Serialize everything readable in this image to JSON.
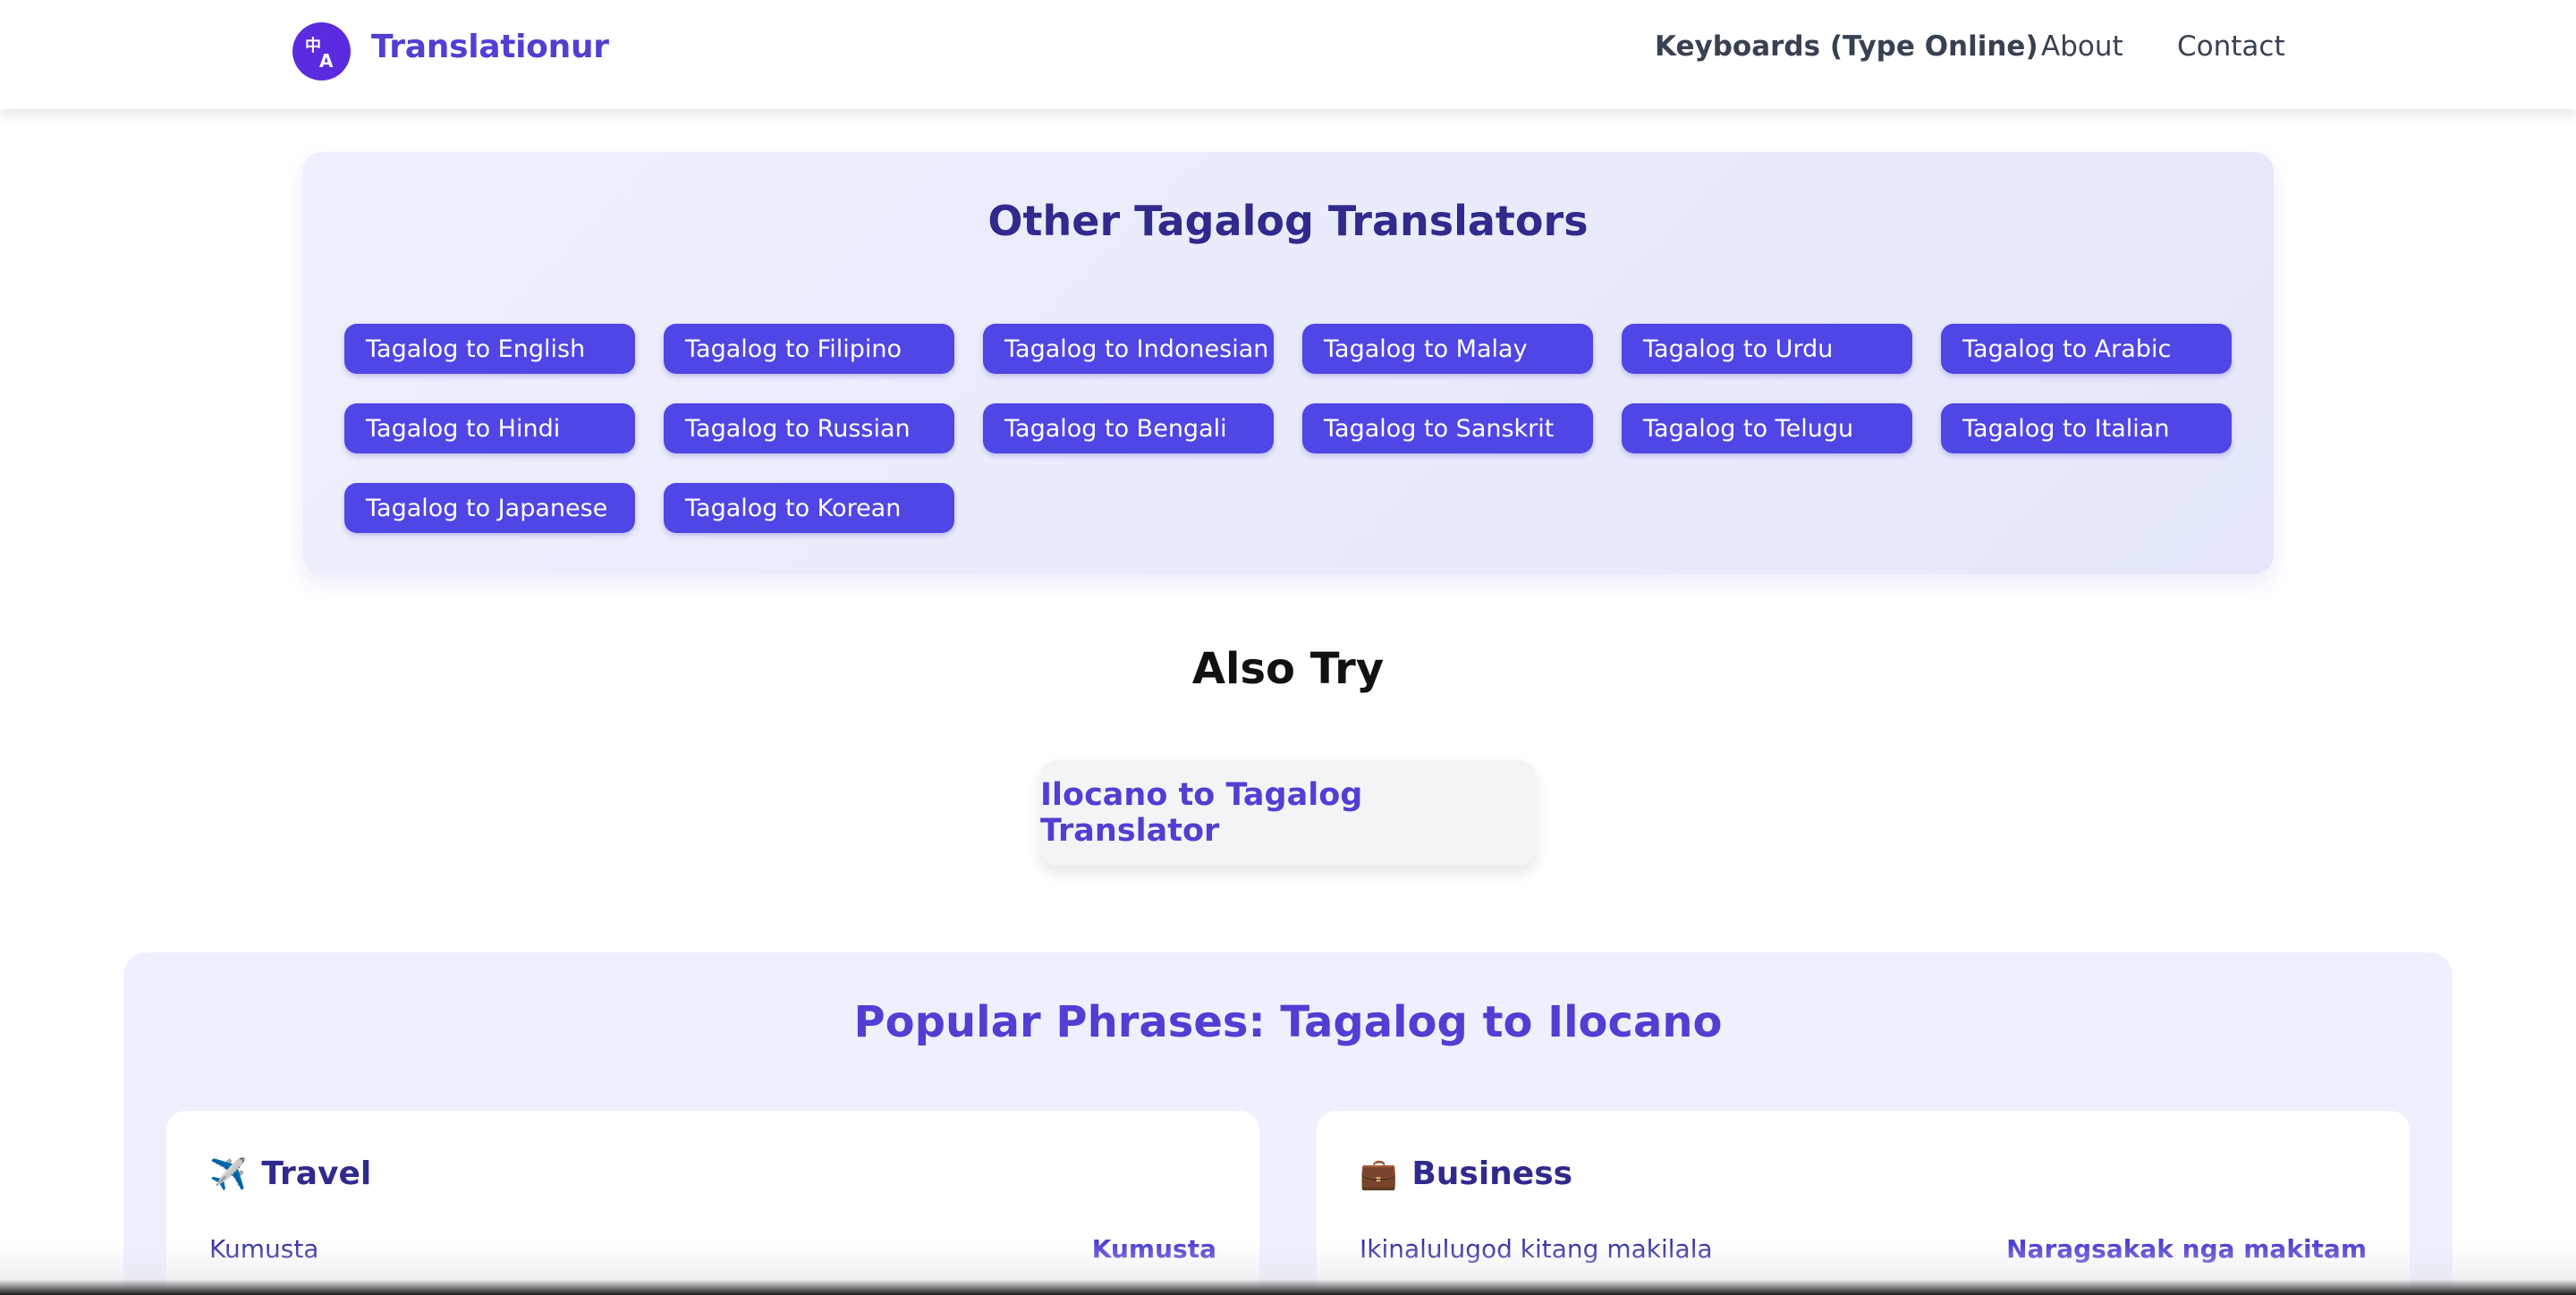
{
  "header": {
    "logo_icon": "translate-icon",
    "logo_glyph": "中A",
    "brand": "Translationur",
    "nav": [
      {
        "label": "Keyboards (Type Online)"
      },
      {
        "label": "About"
      },
      {
        "label": "Contact"
      }
    ]
  },
  "translators": {
    "title": "Other Tagalog Translators",
    "links": [
      "Tagalog to English",
      "Tagalog to Filipino",
      "Tagalog to Indonesian",
      "Tagalog to Malay",
      "Tagalog to Urdu",
      "Tagalog to Arabic",
      "Tagalog to Hindi",
      "Tagalog to Russian",
      "Tagalog to Bengali",
      "Tagalog to Sanskrit",
      "Tagalog to Telugu",
      "Tagalog to Italian",
      "Tagalog to Japanese",
      "Tagalog to Korean"
    ]
  },
  "also_try": {
    "title": "Also Try",
    "link": "Ilocano to Tagalog Translator"
  },
  "phrases": {
    "title": "Popular Phrases: Tagalog to Ilocano",
    "cards": [
      {
        "icon": "airplane-icon",
        "emoji": "✈️",
        "title": "Travel",
        "source": "Kumusta",
        "target": "Kumusta"
      },
      {
        "icon": "briefcase-icon",
        "emoji": "💼",
        "title": "Business",
        "source": "Ikinalulugod kitang makilala",
        "target": "Naragsakak nga makitam"
      }
    ]
  },
  "colors": {
    "accent": "#5046e5",
    "brand": "#4f3fd3",
    "logo": "#5b2be0",
    "panel_bg": "#eef0fd"
  }
}
